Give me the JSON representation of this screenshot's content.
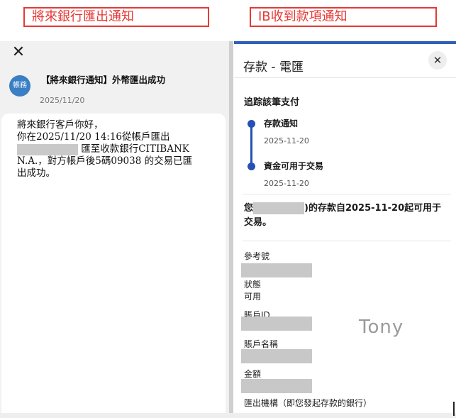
{
  "labels": {
    "left": "將來銀行匯出通知",
    "right": "IB收到款項通知"
  },
  "left_panel": {
    "close_glyph": "✕",
    "avatar_text": "帳務",
    "notification_title": "【將來銀行通知】外幣匯出成功",
    "notification_date": "2025/11/20",
    "message_lines": [
      "將來銀行客戶你好，",
      "你在2025/11/20 14:16從帳戶匯出",
      "匯至收款銀行CITIBANK",
      "N.A.，對方帳戶後5碼09038 的交易已匯",
      "出成功。"
    ]
  },
  "right_panel": {
    "title": "存款 - 電匯",
    "close_glyph": "✕",
    "tracking_label": "追踪該筆支付",
    "steps": [
      {
        "title": "存款通知",
        "date": "2025-11-20"
      },
      {
        "title": "資金可用于交易",
        "date": "2025-11-20"
      }
    ],
    "summary_prefix": "您",
    "summary_suffix": ")的存款自2025-11-20起可用于交易。",
    "fields": {
      "reference": "參考號",
      "status_label": "狀態",
      "status_value": "可用",
      "account_id": "賬戶ID",
      "account_name": "賬戶名稱",
      "amount": "金額",
      "institution": "匯出機構（即您發起存款的銀行）"
    },
    "watermark": "Tony"
  },
  "colors": {
    "label_red": "#e53935",
    "accent_blue": "#2550b5",
    "avatar_blue": "#3a7ec3"
  }
}
